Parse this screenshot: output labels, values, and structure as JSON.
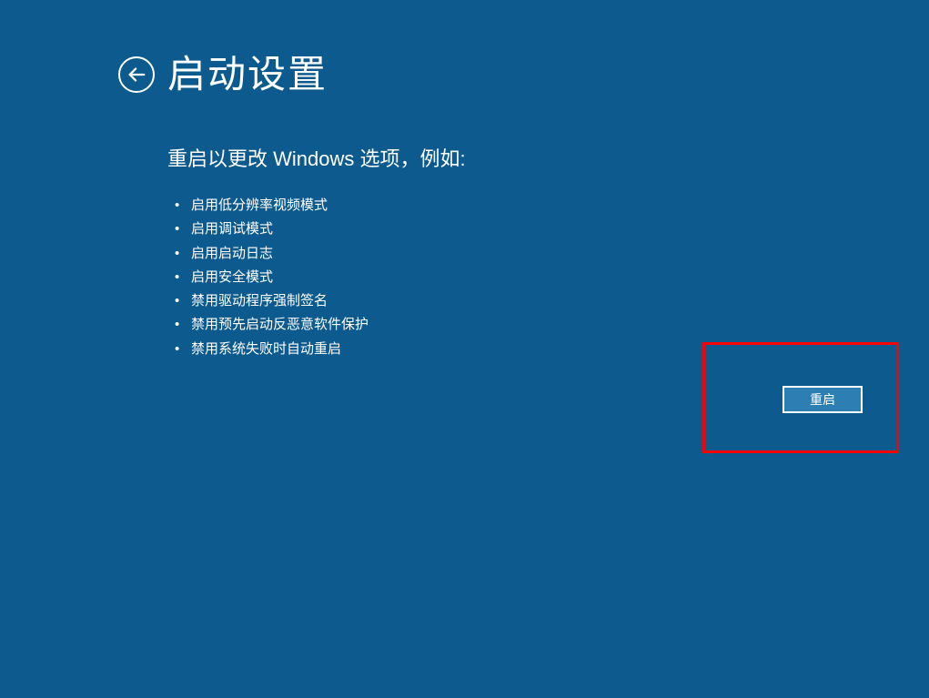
{
  "title": "启动设置",
  "subtitle": "重启以更改 Windows 选项，例如:",
  "options": [
    "启用低分辨率视频模式",
    "启用调试模式",
    "启用启动日志",
    "启用安全模式",
    "禁用驱动程序强制签名",
    "禁用预先启动反恶意软件保护",
    "禁用系统失败时自动重启"
  ],
  "restart_label": "重启"
}
